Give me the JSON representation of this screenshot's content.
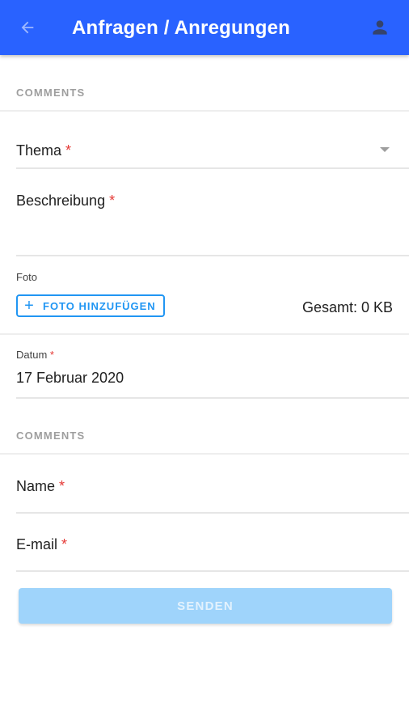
{
  "appbar": {
    "title": "Anfragen / Anregungen",
    "back_icon": "arrow-left-icon",
    "account_icon": "person-icon",
    "color": "#2962ff"
  },
  "section1": {
    "header": "COMMENTS"
  },
  "thema": {
    "label": "Thema",
    "required_mark": "*",
    "dropdown_icon": "caret-down-icon"
  },
  "beschreibung": {
    "label": "Beschreibung",
    "required_mark": "*"
  },
  "foto": {
    "label": "Foto",
    "add_button_label": "FOTO HINZUFÜGEN",
    "add_icon": "plus-icon",
    "total_text": "Gesamt: 0 KB"
  },
  "datum": {
    "label": "Datum",
    "required_mark": "*",
    "value": "17 Februar 2020"
  },
  "section2": {
    "header": "COMMENTS"
  },
  "name": {
    "label": "Name",
    "required_mark": "*"
  },
  "email": {
    "label": "E-mail",
    "required_mark": "*"
  },
  "submit": {
    "label": "SENDEN",
    "state": "disabled"
  },
  "colors": {
    "primary": "#2962ff",
    "accent": "#2196f3",
    "required": "#e53935",
    "disabled_button": "#9fd4fb"
  }
}
